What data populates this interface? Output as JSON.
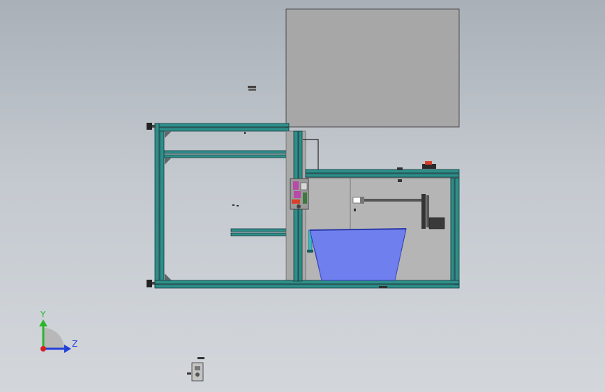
{
  "viewport": {
    "background_top": "#a9b0b8",
    "background_bottom": "#d3d7dc"
  },
  "model": {
    "frame_profile_color": "#2e8e8a",
    "frame_edge_color": "#0f3a3a",
    "panel_color": "#a7a7a7",
    "plate_color": "#b5b5b5",
    "hopper_color": "#6f7fee",
    "accent_magenta": "#b84aa8",
    "accent_red": "#d8402a",
    "motor_color": "#3a3a3a"
  },
  "triad": {
    "y_label": "Y",
    "z_label": "Z",
    "y_color": "#2bb52b",
    "z_color": "#2140d8",
    "x_color": "#d42020"
  }
}
